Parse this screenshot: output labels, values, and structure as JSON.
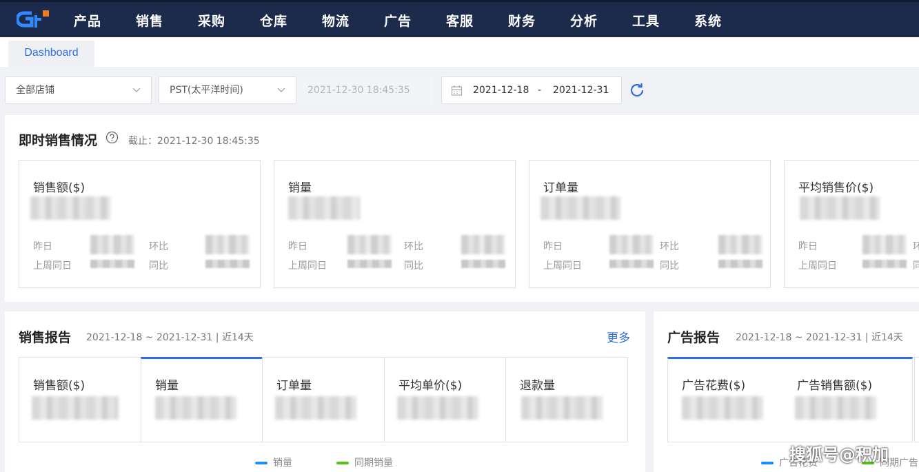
{
  "nav": {
    "items": [
      "产品",
      "销售",
      "采购",
      "仓库",
      "物流",
      "广告",
      "客服",
      "财务",
      "分析",
      "工具",
      "系统"
    ]
  },
  "tabs": {
    "active": "Dashboard"
  },
  "filters": {
    "store_select": "全部店铺",
    "timezone_select": "PST(太平洋时间)",
    "current_time": "2021-12-30 18:45:35",
    "date_start": "2021-12-18",
    "date_sep": "-",
    "date_end": "2021-12-31"
  },
  "realtime": {
    "title": "即时销售情况",
    "as_of": "截止：2021-12-30 18:45:35",
    "cards": [
      {
        "title": "销售额($)",
        "l1": "昨日",
        "l2": "环比",
        "l3": "上周同日",
        "l4": "同比"
      },
      {
        "title": "销量",
        "l1": "昨日",
        "l2": "环比",
        "l3": "上周同日",
        "l4": "同比"
      },
      {
        "title": "订单量",
        "l1": "昨日",
        "l2": "环比",
        "l3": "上周同日",
        "l4": "同比"
      },
      {
        "title": "平均销售价($)",
        "l1": "昨日",
        "l2": "环",
        "l3": "上周同日",
        "l4": "同"
      }
    ]
  },
  "sales_report": {
    "title": "销售报告",
    "range": "2021-12-18 ~ 2021-12-31 | 近14天",
    "more": "更多",
    "cards": [
      "销售额($)",
      "销量",
      "订单量",
      "平均单价($)",
      "退款量"
    ],
    "legend": [
      "销量",
      "同期销量"
    ]
  },
  "ad_report": {
    "title": "广告报告",
    "range": "2021-12-18 ~ 2021-12-31 | 近14天",
    "cards": [
      "广告花费($)",
      "广告销售额($)"
    ],
    "legend": [
      "广告花费",
      "同期广告"
    ]
  },
  "watermark": "搜狐号@积加",
  "colors": {
    "nav_bg": "#1c2a4c",
    "accent": "#2f6ee0",
    "logo_orange": "#f07a22",
    "legend_blue": "#1890ff",
    "legend_green": "#52c41a"
  }
}
